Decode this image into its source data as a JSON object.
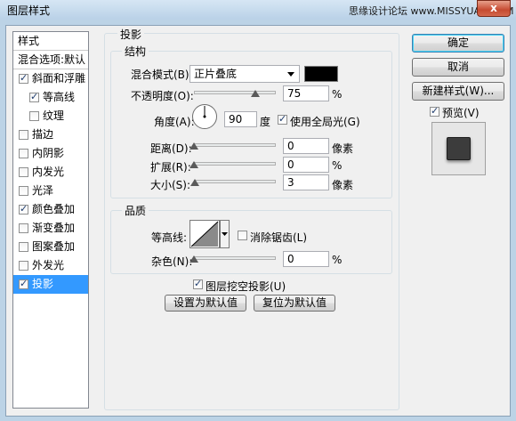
{
  "window": {
    "title": "图层样式",
    "watermark": "思缘设计论坛 www.MISSYUAN.COM",
    "close_glyph": "x"
  },
  "styles_panel": {
    "header": "样式",
    "items": [
      {
        "label": "混合选项:默认",
        "checkbox": false,
        "checked": false,
        "indent": 0,
        "selected": false
      },
      {
        "label": "斜面和浮雕",
        "checkbox": true,
        "checked": true,
        "indent": 0,
        "selected": false
      },
      {
        "label": "等高线",
        "checkbox": true,
        "checked": true,
        "indent": 1,
        "selected": false
      },
      {
        "label": "纹理",
        "checkbox": true,
        "checked": false,
        "indent": 1,
        "selected": false
      },
      {
        "label": "描边",
        "checkbox": true,
        "checked": false,
        "indent": 0,
        "selected": false
      },
      {
        "label": "内阴影",
        "checkbox": true,
        "checked": false,
        "indent": 0,
        "selected": false
      },
      {
        "label": "内发光",
        "checkbox": true,
        "checked": false,
        "indent": 0,
        "selected": false
      },
      {
        "label": "光泽",
        "checkbox": true,
        "checked": false,
        "indent": 0,
        "selected": false
      },
      {
        "label": "颜色叠加",
        "checkbox": true,
        "checked": true,
        "indent": 0,
        "selected": false
      },
      {
        "label": "渐变叠加",
        "checkbox": true,
        "checked": false,
        "indent": 0,
        "selected": false
      },
      {
        "label": "图案叠加",
        "checkbox": true,
        "checked": false,
        "indent": 0,
        "selected": false
      },
      {
        "label": "外发光",
        "checkbox": true,
        "checked": false,
        "indent": 0,
        "selected": false
      },
      {
        "label": "投影",
        "checkbox": true,
        "checked": true,
        "indent": 0,
        "selected": true
      }
    ]
  },
  "drop_shadow": {
    "section_title": "投影",
    "structure": {
      "title": "结构",
      "blend_mode_label": "混合模式(B):",
      "blend_mode_value": "正片叠底",
      "shadow_color": "#000000",
      "opacity_label": "不透明度(O):",
      "opacity_value": "75",
      "opacity_unit": "%",
      "opacity_fraction": 0.75,
      "angle_label": "角度(A):",
      "angle_value": "90",
      "angle_unit": "度",
      "global_light_label": "使用全局光(G)",
      "global_light_checked": true,
      "distance_label": "距离(D):",
      "distance_value": "0",
      "distance_unit": "像素",
      "distance_fraction": 0,
      "spread_label": "扩展(R):",
      "spread_value": "0",
      "spread_unit": "%",
      "spread_fraction": 0,
      "size_label": "大小(S):",
      "size_value": "3",
      "size_unit": "像素",
      "size_fraction": 0.015
    },
    "quality": {
      "title": "品质",
      "contour_label": "等高线:",
      "antialias_label": "消除锯齿(L)",
      "antialias_checked": false,
      "noise_label": "杂色(N):",
      "noise_value": "0",
      "noise_unit": "%",
      "noise_fraction": 0
    },
    "knockout_label": "图层挖空投影(U)",
    "knockout_checked": true,
    "make_default_label": "设置为默认值",
    "reset_default_label": "复位为默认值"
  },
  "buttons": {
    "ok": "确定",
    "cancel": "取消",
    "new_style": "新建样式(W)...",
    "preview_label": "预览(V)",
    "preview_checked": true
  },
  "check_glyph": "✓"
}
